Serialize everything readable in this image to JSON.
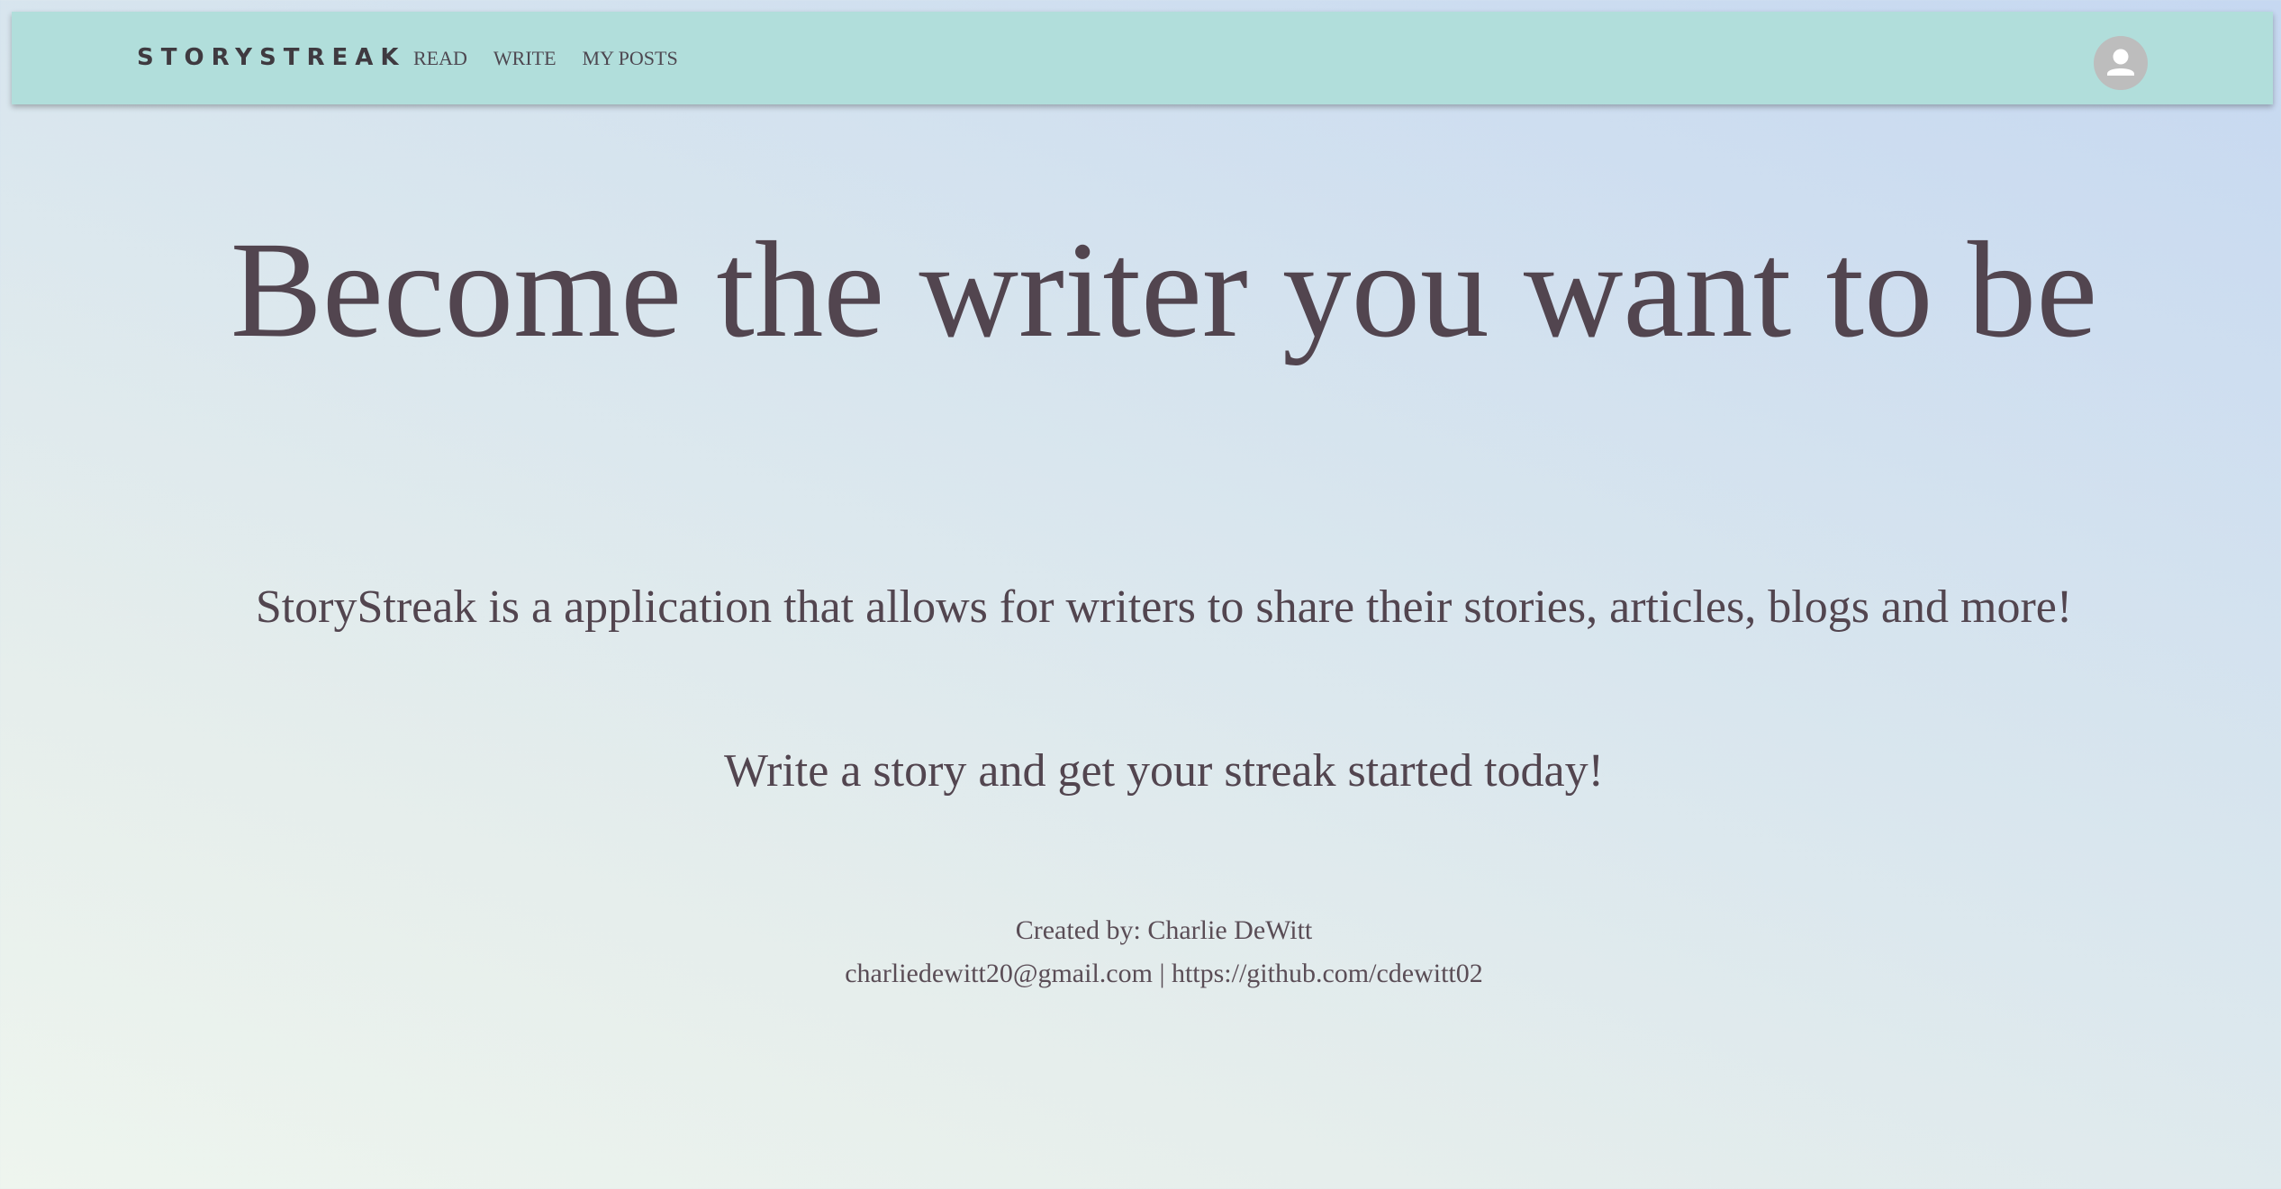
{
  "nav": {
    "brand": "STORYSTREAK",
    "links": [
      "READ",
      "WRITE",
      "MY POSTS"
    ],
    "avatar_icon": "account-circle-icon"
  },
  "hero": {
    "title": "Become the writer you want to be",
    "description": "StoryStreak is a application that allows for writers to share their stories, articles, blogs and more!",
    "cta": "Write a story and get your streak started today!"
  },
  "footer": {
    "created_by": "Created by: Charlie DeWitt",
    "email": "charliedewitt20@gmail.com",
    "separator": "|",
    "github": "https://github.com/cdewitt02"
  },
  "colors": {
    "navbar": "#b1dedb",
    "text": "#52454f",
    "avatar": "#bdbdbd"
  }
}
